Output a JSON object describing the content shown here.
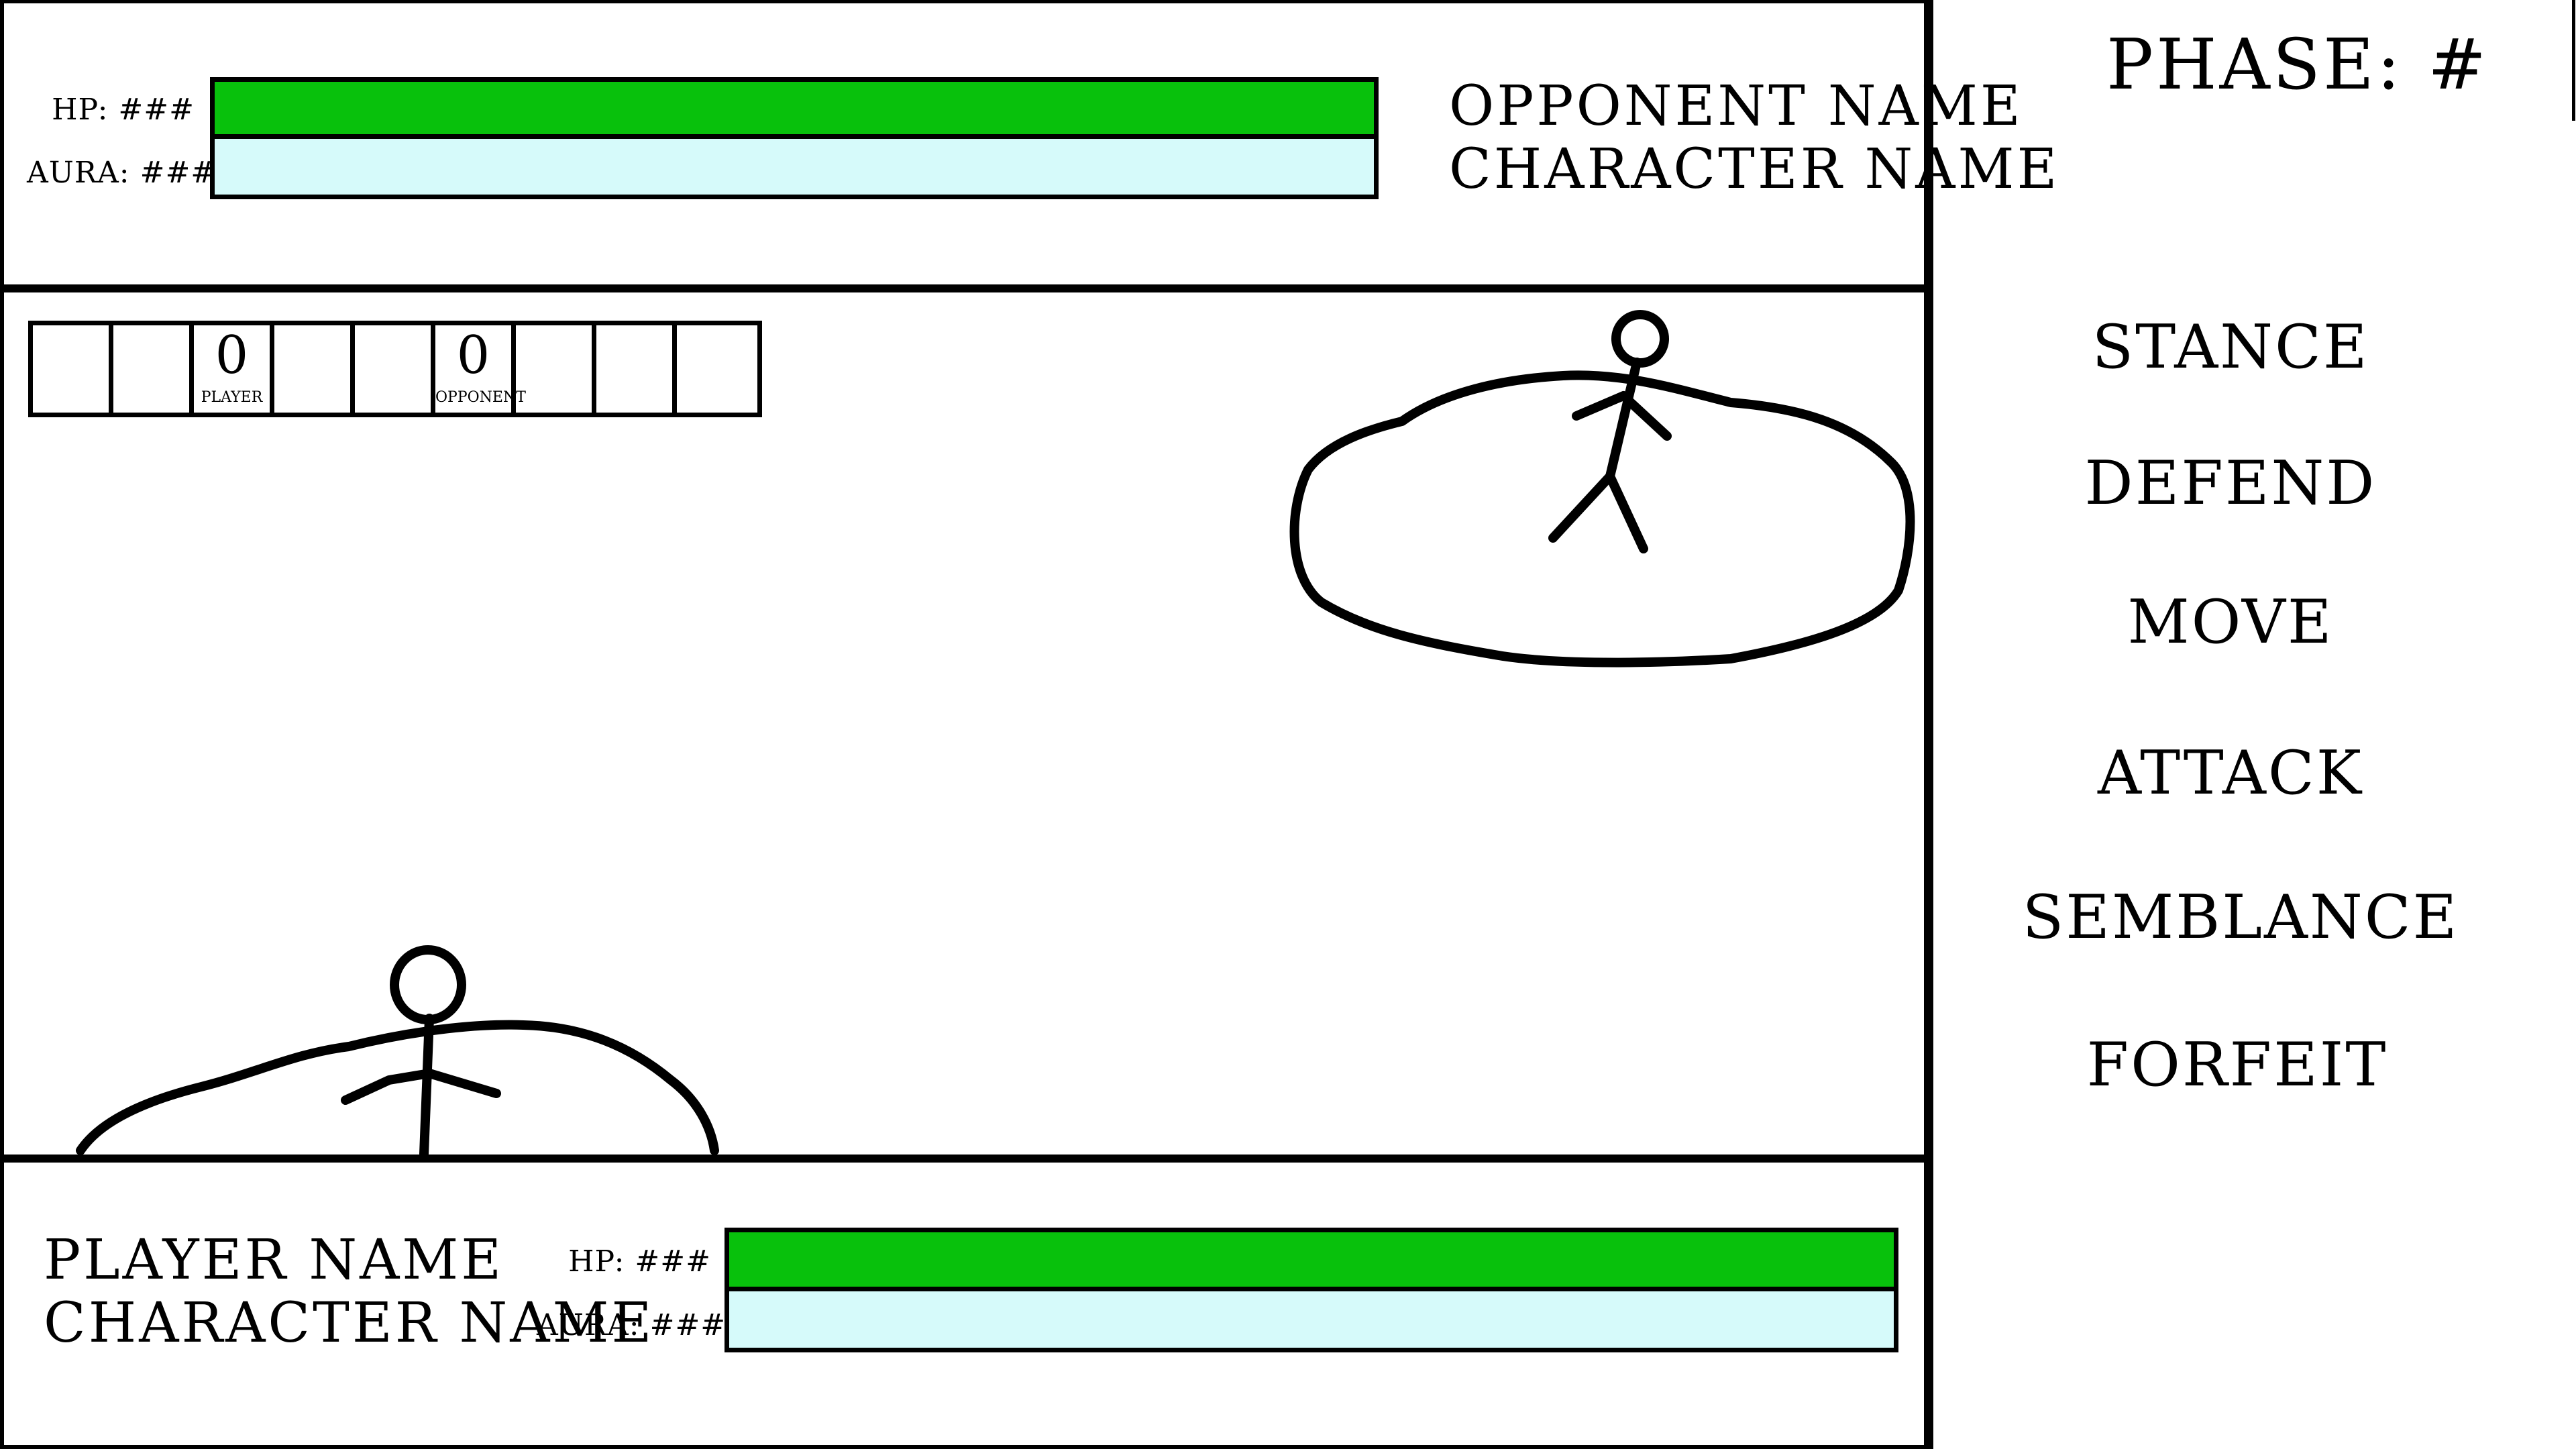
{
  "opponent": {
    "hp_label": "HP: ###",
    "aura_label": "AURA: ###",
    "name": "OPPONENT NAME",
    "character": "CHARACTER NAME",
    "hp_fraction": 1.0,
    "aura_fraction": 1.0
  },
  "player": {
    "hp_label": "HP: ###",
    "aura_label": "AURA: ###",
    "name": "PLAYER NAME",
    "character": "CHARACTER NAME",
    "hp_fraction": 1.0,
    "aura_fraction": 1.0
  },
  "colors": {
    "hp": "#08c10c",
    "aura": "#d6fafa"
  },
  "phase": {
    "label": "PHASE: #"
  },
  "menu": {
    "items": [
      "STANCE",
      "DEFEND",
      "MOVE",
      "ATTACK",
      "SEMBLANCE",
      "FORFEIT"
    ]
  },
  "track": {
    "cell_count": 9,
    "tokens": [
      {
        "cell": 2,
        "mark": "0",
        "label": "PLAYER"
      },
      {
        "cell": 5,
        "mark": "0",
        "label": "OPPONENT"
      }
    ]
  }
}
